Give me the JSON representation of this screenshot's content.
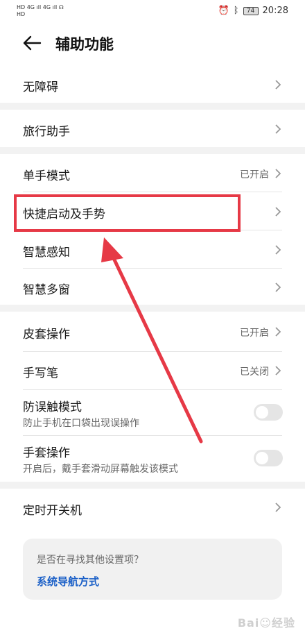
{
  "status_bar": {
    "left_row1": "HD 4G ıll 4G ıll ☊",
    "left_row2": "HD",
    "battery": "74",
    "time": "20:28"
  },
  "header": {
    "title": "辅助功能"
  },
  "items": [
    {
      "label": "无障碍"
    },
    {
      "label": "旅行助手"
    },
    {
      "label": "单手模式",
      "status": "已开启"
    },
    {
      "label": "快捷启动及手势"
    },
    {
      "label": "智慧感知"
    },
    {
      "label": "智慧多窗"
    },
    {
      "label": "皮套操作",
      "status": "已开启"
    },
    {
      "label": "手写笔",
      "status": "已关闭"
    },
    {
      "label": "防误触模式",
      "sub": "防止手机在口袋出现误操作",
      "toggle": false
    },
    {
      "label": "手套操作",
      "sub": "开启后，戴手套滑动屏幕触发该模式",
      "toggle": false
    },
    {
      "label": "定时开关机"
    }
  ],
  "suggest": {
    "question": "是否在寻找其他设置项？",
    "link": "系统导航方式"
  },
  "watermark": "Bai☺经验",
  "colors": {
    "highlight": "#e63946",
    "link": "#1a5fc7"
  }
}
